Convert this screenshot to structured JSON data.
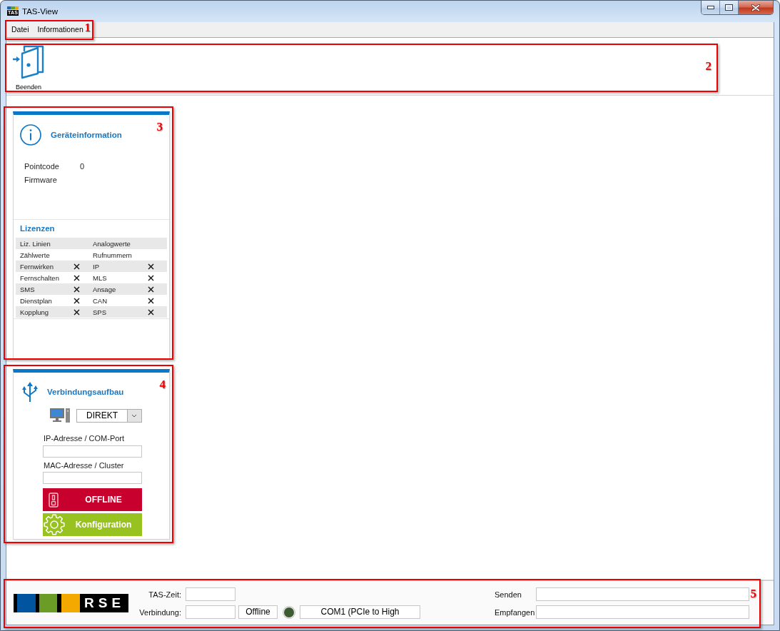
{
  "window": {
    "title": "TAS-View",
    "icon_text": "TAS"
  },
  "menu": [
    {
      "label": "Datei"
    },
    {
      "label": "Informationen"
    }
  ],
  "toolbar": [
    {
      "label": "Beenden",
      "kind": "exit"
    }
  ],
  "device_info": {
    "title": "Geräteinformation",
    "fields": [
      {
        "label": "Pointcode",
        "value": "0"
      },
      {
        "label": "Firmware"
      }
    ],
    "licenses_title": "Lizenzen",
    "licenses": [
      {
        "label": "Liz. Linien",
        "kind": "count"
      },
      {
        "label": "Analogwerte",
        "kind": "count"
      },
      {
        "label": "Zählwerte",
        "kind": "count"
      },
      {
        "label": "Rufnummern",
        "kind": "count"
      },
      {
        "label": "Fernwirken",
        "kind": "feature",
        "licensed": false
      },
      {
        "label": "IP",
        "kind": "feature",
        "licensed": false
      },
      {
        "label": "Fernschalten",
        "kind": "feature",
        "licensed": false
      },
      {
        "label": "MLS",
        "kind": "feature",
        "licensed": false
      },
      {
        "label": "SMS",
        "kind": "feature",
        "licensed": false
      },
      {
        "label": "Ansage",
        "kind": "feature",
        "licensed": false
      },
      {
        "label": "Dienstplan",
        "kind": "feature",
        "licensed": false
      },
      {
        "label": "CAN",
        "kind": "feature",
        "licensed": false
      },
      {
        "label": "Kopplung",
        "kind": "feature",
        "licensed": false
      },
      {
        "label": "SPS",
        "kind": "feature",
        "licensed": false
      }
    ]
  },
  "connection": {
    "title": "Verbindungsaufbau",
    "mode": "DIREKT",
    "fields": [
      {
        "label": "IP-Adresse / COM-Port"
      },
      {
        "label": "MAC-Adresse / Cluster"
      }
    ],
    "buttons": [
      {
        "label": "OFFLINE",
        "kind": "status"
      },
      {
        "label": "Konfiguration",
        "kind": "config"
      }
    ]
  },
  "status_bar": {
    "logo": "RSE",
    "time_label": "TAS-Zeit:",
    "connection_label": "Verbindung:",
    "state": "Offline",
    "connected": false,
    "port": "COM1 (PCIe to High",
    "send_label": "Senden",
    "receive_label": "Empfangen"
  },
  "annotations": [
    {
      "label": "1"
    },
    {
      "label": "2"
    },
    {
      "label": "3"
    },
    {
      "label": "4"
    },
    {
      "label": "5"
    }
  ]
}
